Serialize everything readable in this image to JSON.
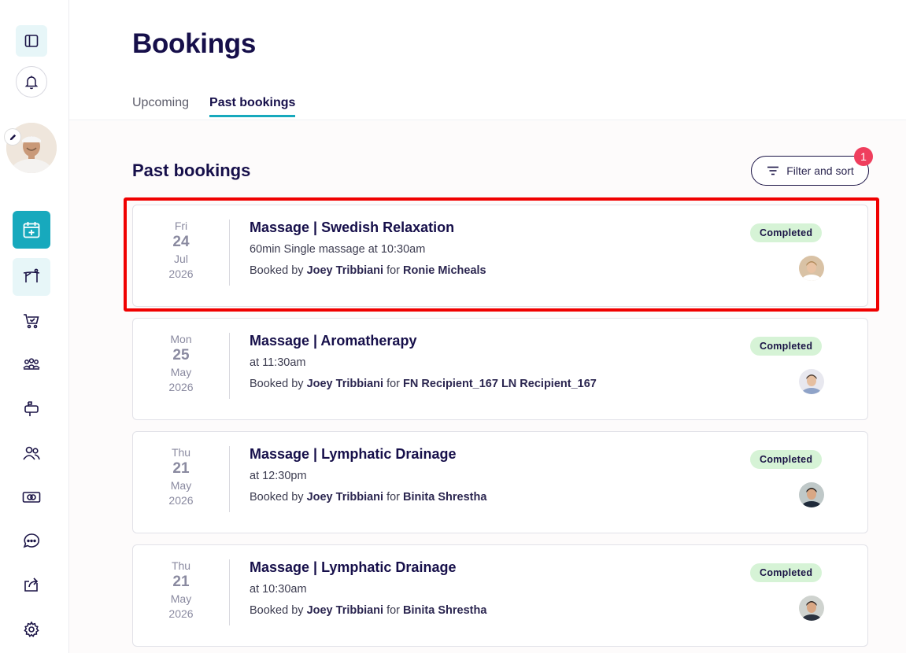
{
  "header": {
    "title": "Bookings",
    "tabs": [
      {
        "label": "Upcoming",
        "active": false
      },
      {
        "label": "Past bookings",
        "active": true
      }
    ]
  },
  "section": {
    "title": "Past bookings",
    "filter_label": "Filter and sort",
    "filter_count": "1"
  },
  "colors": {
    "accent": "#17a9bd",
    "badge": "#ef3e5d",
    "status_bg": "#d6f3d6",
    "highlight": "#f00000"
  },
  "sidebar": {
    "items": [
      "panel-toggle-icon",
      "bell-icon",
      "calendar-plus-icon",
      "massage-table-icon",
      "cart-icon",
      "group-icon",
      "mailbox-icon",
      "users-icon",
      "money-icon",
      "chat-icon",
      "share-icon",
      "gear-icon"
    ]
  },
  "bookings": [
    {
      "dow": "Fri",
      "day": "24",
      "month": "Jul",
      "year": "2026",
      "title": "Massage | Swedish Relaxation",
      "sub": "60min Single massage at 10:30am",
      "booked_prefix": "Booked by",
      "booker": "Joey Tribbiani",
      "for_word": "for",
      "recipient": "Ronie Micheals",
      "status": "Completed"
    },
    {
      "dow": "Mon",
      "day": "25",
      "month": "May",
      "year": "2026",
      "title": "Massage | Aromatherapy",
      "sub": "at 11:30am",
      "booked_prefix": "Booked by",
      "booker": "Joey Tribbiani",
      "for_word": "for",
      "recipient": "FN Recipient_167 LN Recipient_167",
      "status": "Completed"
    },
    {
      "dow": "Thu",
      "day": "21",
      "month": "May",
      "year": "2026",
      "title": "Massage | Lymphatic Drainage",
      "sub": "at 12:30pm",
      "booked_prefix": "Booked by",
      "booker": "Joey Tribbiani",
      "for_word": "for",
      "recipient": "Binita Shrestha",
      "status": "Completed"
    },
    {
      "dow": "Thu",
      "day": "21",
      "month": "May",
      "year": "2026",
      "title": "Massage | Lymphatic Drainage",
      "sub": "at 10:30am",
      "booked_prefix": "Booked by",
      "booker": "Joey Tribbiani",
      "for_word": "for",
      "recipient": "Binita Shrestha",
      "status": "Completed"
    }
  ]
}
